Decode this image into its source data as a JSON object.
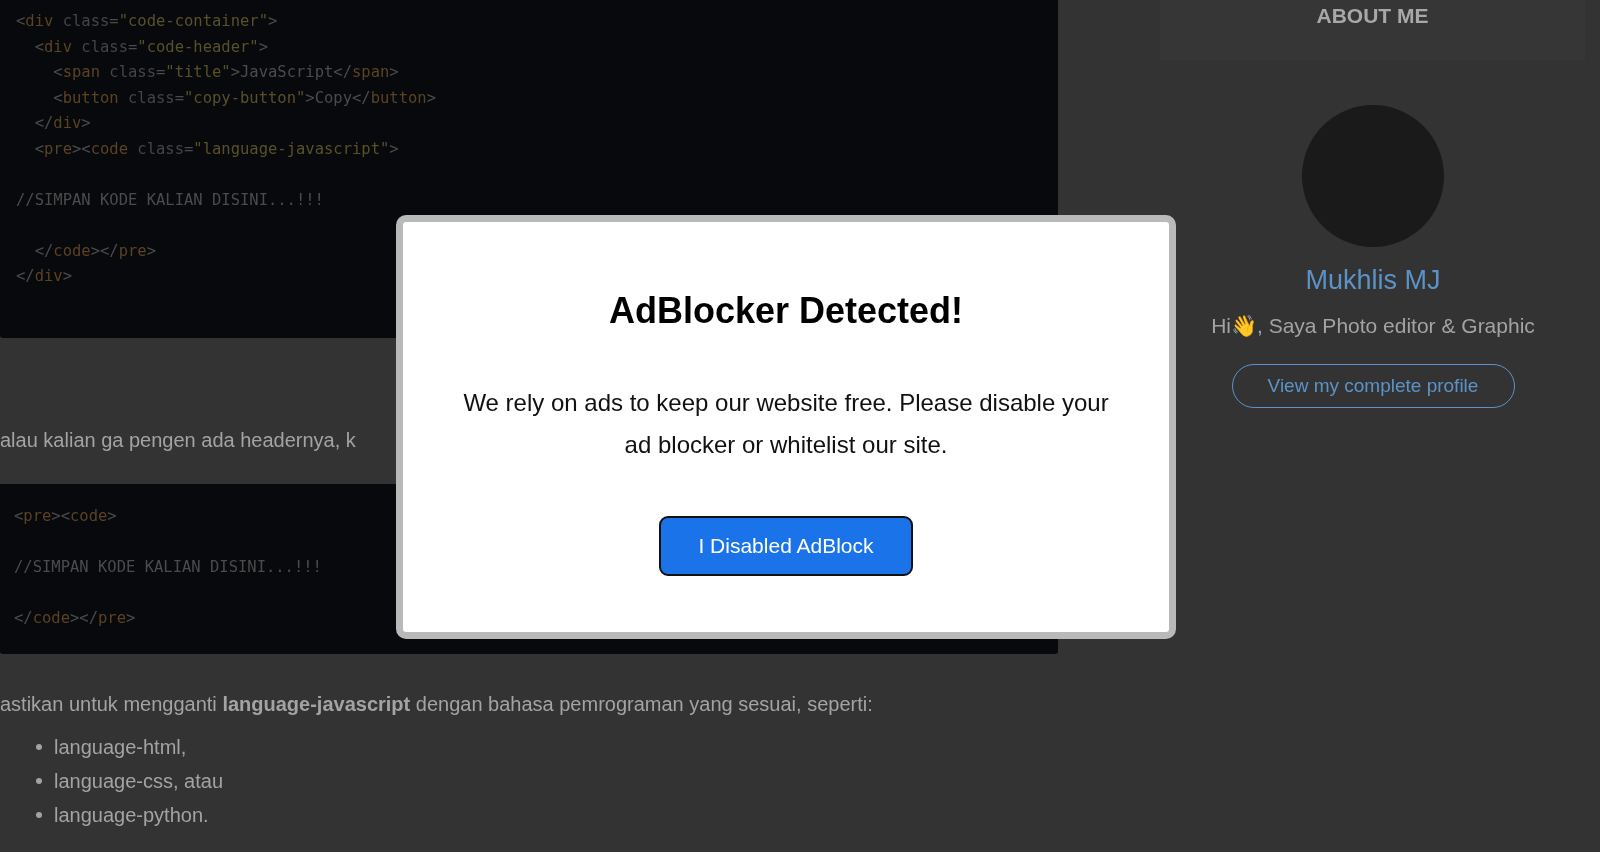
{
  "code_blocks": [
    {
      "groups": [
        [
          [
            {
              "kind": "p",
              "text": "<"
            },
            {
              "kind": "tag",
              "text": "div"
            },
            {
              "kind": "attr",
              "text": " class"
            },
            {
              "kind": "p",
              "text": "="
            },
            {
              "kind": "str",
              "text": "\"code-container\""
            },
            {
              "kind": "p",
              "text": ">"
            }
          ],
          [
            {
              "kind": "p",
              "text": "  <"
            },
            {
              "kind": "tag",
              "text": "div"
            },
            {
              "kind": "attr",
              "text": " class"
            },
            {
              "kind": "p",
              "text": "="
            },
            {
              "kind": "str",
              "text": "\"code-header\""
            },
            {
              "kind": "p",
              "text": ">"
            }
          ],
          [
            {
              "kind": "p",
              "text": "    <"
            },
            {
              "kind": "tag",
              "text": "span"
            },
            {
              "kind": "attr",
              "text": " class"
            },
            {
              "kind": "p",
              "text": "="
            },
            {
              "kind": "str",
              "text": "\"title\""
            },
            {
              "kind": "p",
              "text": ">JavaScript</"
            },
            {
              "kind": "tag",
              "text": "span"
            },
            {
              "kind": "p",
              "text": ">"
            }
          ],
          [
            {
              "kind": "p",
              "text": "    <"
            },
            {
              "kind": "tag",
              "text": "button"
            },
            {
              "kind": "attr",
              "text": " class"
            },
            {
              "kind": "p",
              "text": "="
            },
            {
              "kind": "str",
              "text": "\"copy-button\""
            },
            {
              "kind": "p",
              "text": ">Copy</"
            },
            {
              "kind": "tag",
              "text": "button"
            },
            {
              "kind": "p",
              "text": ">"
            }
          ],
          [
            {
              "kind": "p",
              "text": "  </"
            },
            {
              "kind": "tag",
              "text": "div"
            },
            {
              "kind": "p",
              "text": ">"
            }
          ],
          [
            {
              "kind": "p",
              "text": "  <"
            },
            {
              "kind": "tag",
              "text": "pre"
            },
            {
              "kind": "p",
              "text": "><"
            },
            {
              "kind": "tag",
              "text": "code"
            },
            {
              "kind": "attr",
              "text": " class"
            },
            {
              "kind": "p",
              "text": "="
            },
            {
              "kind": "str",
              "text": "\"language-javascript\""
            },
            {
              "kind": "p",
              "text": ">"
            }
          ]
        ],
        [
          [
            {
              "kind": "p",
              "text": "//SIMPAN KODE KALIAN DISINI...!!!"
            }
          ]
        ],
        [
          [
            {
              "kind": "p",
              "text": "  </"
            },
            {
              "kind": "tag",
              "text": "code"
            },
            {
              "kind": "p",
              "text": "></"
            },
            {
              "kind": "tag",
              "text": "pre"
            },
            {
              "kind": "p",
              "text": ">"
            }
          ],
          [
            {
              "kind": "p",
              "text": "</"
            },
            {
              "kind": "tag",
              "text": "div"
            },
            {
              "kind": "p",
              "text": ">"
            }
          ]
        ]
      ]
    },
    {
      "groups": [
        [
          [
            {
              "kind": "p",
              "text": "<"
            },
            {
              "kind": "tag",
              "text": "pre"
            },
            {
              "kind": "p",
              "text": "><"
            },
            {
              "kind": "tag",
              "text": "code"
            },
            {
              "kind": "p",
              "text": ">"
            }
          ]
        ],
        [
          [
            {
              "kind": "p",
              "text": "//SIMPAN KODE KALIAN DISINI...!!!"
            }
          ]
        ],
        [
          [
            {
              "kind": "p",
              "text": "</"
            },
            {
              "kind": "tag",
              "text": "code"
            },
            {
              "kind": "p",
              "text": "></"
            },
            {
              "kind": "tag",
              "text": "pre"
            },
            {
              "kind": "p",
              "text": ">"
            }
          ]
        ]
      ]
    }
  ],
  "paragraph_1": "alau kalian ga pengen ada headernya, k",
  "paragraph_2": "astikan untuk mengganti **language-javascript** dengan bahasa pemrograman yang sesuai, seperti:",
  "list": [
    "language-html,",
    "language-css, atau",
    "language-python."
  ],
  "sidebar": {
    "heading": "ABOUT ME",
    "name": "Mukhlis MJ",
    "bio": "Hi👋, Saya Photo editor & Graphic",
    "profile_button": "View my complete profile"
  },
  "modal": {
    "title": "AdBlocker Detected!",
    "message": "We rely on ads to keep our website free. Please disable your ad blocker or whitelist our site.",
    "button": "I Disabled AdBlock"
  }
}
